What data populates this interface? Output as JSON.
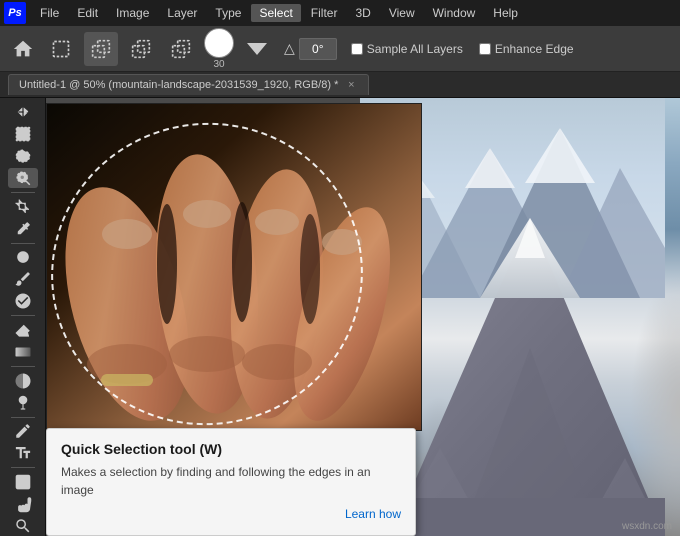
{
  "app": {
    "icon_label": "Ps",
    "icon_color": "#001aff"
  },
  "menu": {
    "items": [
      "File",
      "Edit",
      "Image",
      "Layer",
      "Type",
      "Select",
      "Filter",
      "3D",
      "View",
      "Window",
      "Help"
    ]
  },
  "options_bar": {
    "brush_size": "30",
    "angle_value": "0°",
    "angle_symbol": "△",
    "sample_all_layers_label": "Sample All Layers",
    "enhance_edge_label": "Enhance Edge",
    "sample_all_layers_checked": false,
    "enhance_edge_checked": false
  },
  "tab": {
    "title": "Untitled-1 @ 50% (mountain-landscape-2031539_1920, RGB/8) *",
    "close_symbol": "×"
  },
  "toolbar": {
    "tools": [
      {
        "name": "move",
        "symbol": "⊹"
      },
      {
        "name": "marquee",
        "symbol": "▭"
      },
      {
        "name": "lasso",
        "symbol": "⌒"
      },
      {
        "name": "quick-selection",
        "symbol": "◎"
      },
      {
        "name": "crop",
        "symbol": "⊡"
      },
      {
        "name": "eyedropper",
        "symbol": "✒"
      },
      {
        "name": "healing",
        "symbol": "⊕"
      },
      {
        "name": "brush",
        "symbol": "✏"
      },
      {
        "name": "clone",
        "symbol": "⊛"
      },
      {
        "name": "eraser",
        "symbol": "◻"
      },
      {
        "name": "gradient",
        "symbol": "▤"
      },
      {
        "name": "blur",
        "symbol": "◑"
      },
      {
        "name": "dodge",
        "symbol": "◐"
      },
      {
        "name": "pen",
        "symbol": "✒"
      },
      {
        "name": "type",
        "symbol": "T"
      },
      {
        "name": "path-selection",
        "symbol": "↖"
      },
      {
        "name": "shape",
        "symbol": "◻"
      },
      {
        "name": "hand",
        "symbol": "✋"
      },
      {
        "name": "zoom",
        "symbol": "🔍"
      }
    ]
  },
  "tooltip": {
    "title": "Quick Selection tool (W)",
    "description": "Makes a selection by finding and following the edges in an image",
    "link": "Learn how"
  },
  "watermark": "wsxdn.com"
}
